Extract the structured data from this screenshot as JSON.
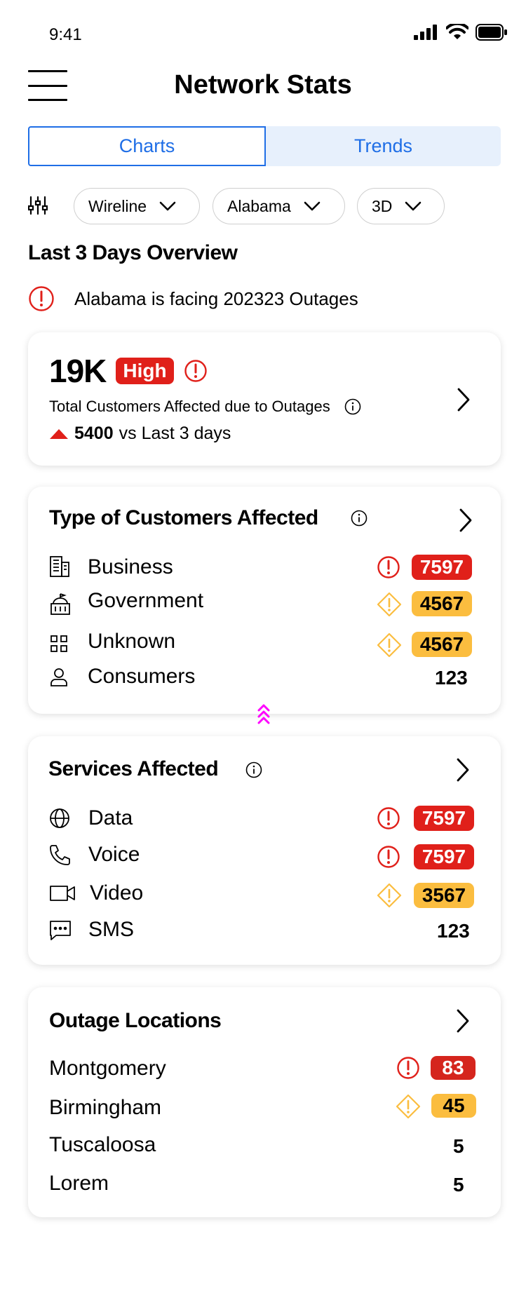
{
  "status": {
    "time": "9:41"
  },
  "header": {
    "title": "Network Stats"
  },
  "tabs": [
    {
      "label": "Charts"
    },
    {
      "label": "Trends"
    }
  ],
  "filters": [
    {
      "label": "Wireline"
    },
    {
      "label": "Alabama"
    },
    {
      "label": "3D"
    }
  ],
  "overview": {
    "title": "Last 3 Days Overview",
    "alert": "Alabama is facing 202323 Outages"
  },
  "summary_card": {
    "value": "19K",
    "badge": "High",
    "label": "Total Customers Affected due to Outages",
    "delta_value": "5400",
    "delta_text": "vs Last 3 days"
  },
  "customers_card": {
    "title": "Type of Customers Affected",
    "rows": [
      {
        "label": "Business",
        "value": "7597"
      },
      {
        "label": "Government",
        "value": "4567"
      },
      {
        "label": "Unknown",
        "value": "4567"
      },
      {
        "label": "Consumers",
        "value": "123"
      }
    ]
  },
  "services_card": {
    "title": "Services Affected",
    "rows": [
      {
        "label": "Data",
        "value": "7597"
      },
      {
        "label": "Voice",
        "value": "7597"
      },
      {
        "label": "Video",
        "value": "3567"
      },
      {
        "label": "SMS",
        "value": "123"
      }
    ]
  },
  "locations_card": {
    "title": "Outage Locations",
    "rows": [
      {
        "label": "Montgomery",
        "value": "83"
      },
      {
        "label": "Birmingham",
        "value": "45"
      },
      {
        "label": "Tuscaloosa",
        "value": "5"
      },
      {
        "label": "Lorem",
        "value": "5"
      }
    ]
  },
  "colors": {
    "accent": "#1f6ee6",
    "critical": "#e0201a",
    "warning": "#fbbd3f",
    "drag_handle": "#ff00ff"
  }
}
